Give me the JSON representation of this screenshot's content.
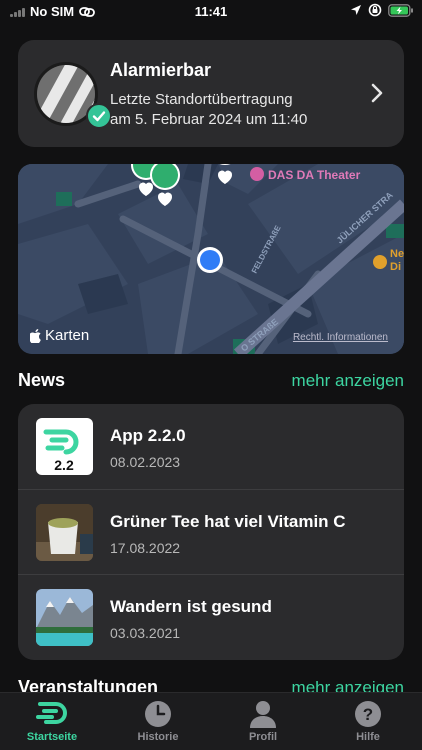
{
  "status_bar": {
    "carrier": "No SIM",
    "time": "11:41"
  },
  "alarm": {
    "title": "Alarmierbar",
    "subtitle_line1": "Letzte Standortübertragung",
    "subtitle_line2": "am 5. Februar 2024 um 11:40"
  },
  "map": {
    "poi_label": "DAS DA Theater",
    "poi_label_partial": "Ne",
    "poi_label_partial2": "Di",
    "street1": "FELDSTRAßE",
    "street2": "JÜLICHER STRA",
    "street3": "O STRAßE",
    "attribution": "Karten",
    "legal": "Rechtl. Informationen"
  },
  "news": {
    "title": "News",
    "more": "mehr anzeigen",
    "items": [
      {
        "title": "App 2.2.0",
        "date": "08.02.2023",
        "badge": "2.2"
      },
      {
        "title": "Grüner Tee hat viel Vitamin C",
        "date": "17.08.2022"
      },
      {
        "title": "Wandern ist gesund",
        "date": "03.03.2021"
      }
    ]
  },
  "events": {
    "title": "Veranstaltungen",
    "more": "mehr anzeigen"
  },
  "tabs": [
    {
      "label": "Startseite",
      "icon": "logo-icon",
      "active": true
    },
    {
      "label": "Historie",
      "icon": "clock-icon",
      "active": false
    },
    {
      "label": "Profil",
      "icon": "person-icon",
      "active": false
    },
    {
      "label": "Hilfe",
      "icon": "help-icon",
      "active": false
    }
  ],
  "colors": {
    "accent": "#3dd5a1",
    "card": "#2b2b2d",
    "background": "#111112",
    "map_pin": "#2fae6e",
    "location_dot": "#2f7cf6"
  }
}
